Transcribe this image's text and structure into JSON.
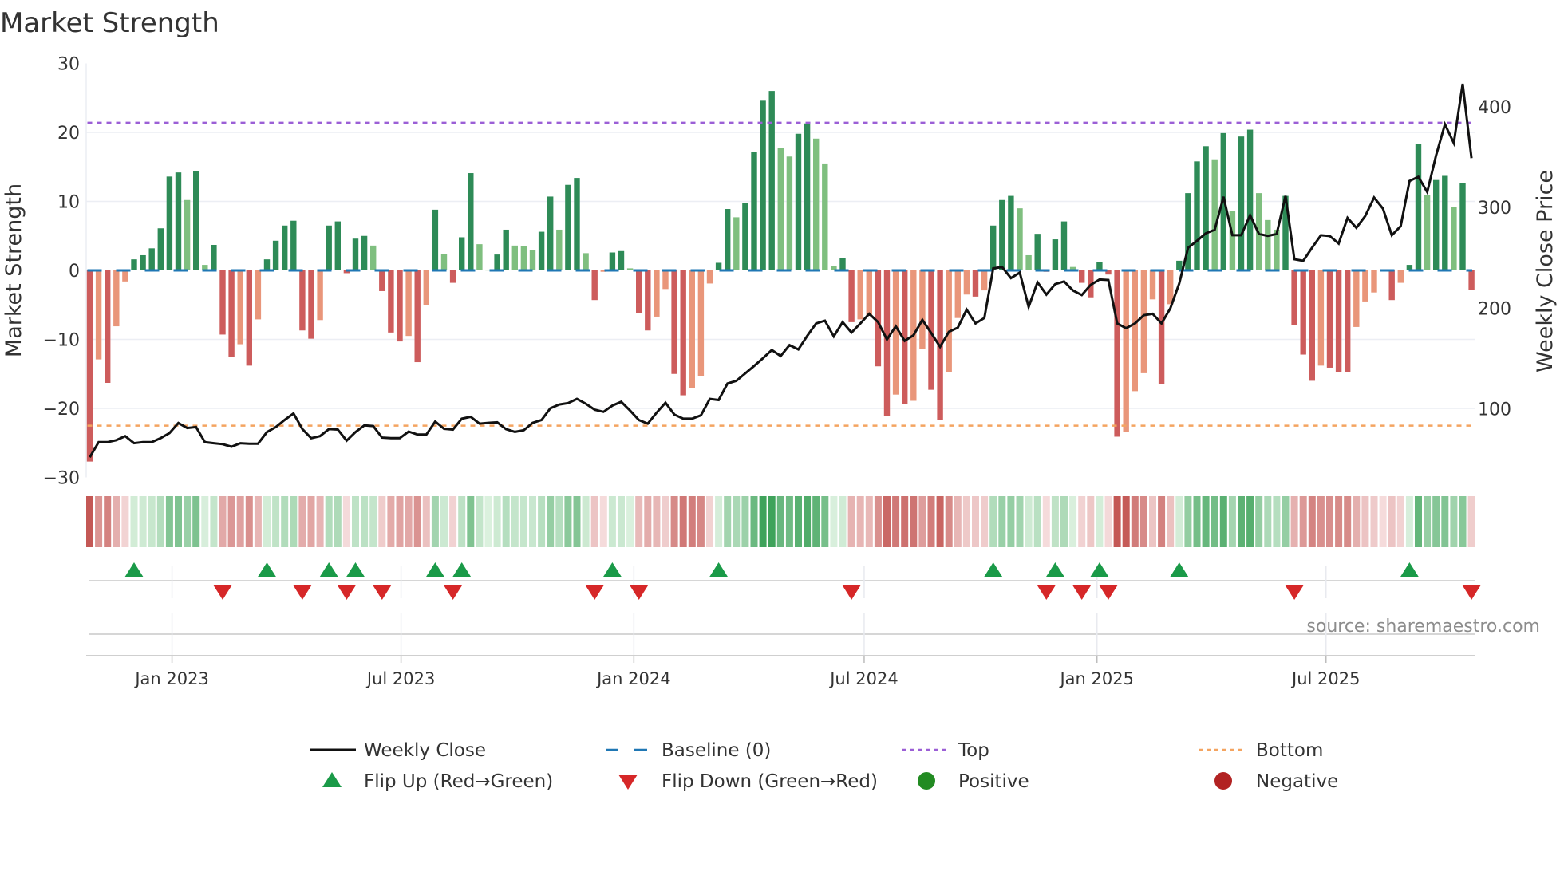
{
  "chart_data": {
    "type": "bar",
    "title": "Market Strength",
    "ylabel": "Market Strength",
    "ylabel_right": "Weekly Close Price",
    "ylim": [
      -30,
      30
    ],
    "ylim_right": [
      32,
      443
    ],
    "yticks": [
      30,
      20,
      10,
      0,
      -10,
      -20,
      -30
    ],
    "yticks_right": [
      400,
      300,
      200,
      100
    ],
    "x_start": "2022-10-28",
    "x_step_days": 7,
    "xticks": [
      {
        "date": "2023-01-01",
        "label": "Jan 2023"
      },
      {
        "date": "2023-07-01",
        "label": "Jul 2023"
      },
      {
        "date": "2024-01-01",
        "label": "Jan 2024"
      },
      {
        "date": "2024-07-01",
        "label": "Jul 2024"
      },
      {
        "date": "2025-01-01",
        "label": "Jan 2025"
      },
      {
        "date": "2025-07-01",
        "label": "Jul 2025"
      }
    ],
    "top_level": 21.4,
    "bottom_level": -22.5,
    "baseline": 0,
    "strength": [
      -27.7,
      -12.9,
      -16.3,
      -8.1,
      -1.6,
      1.6,
      2.2,
      3.2,
      6.1,
      13.6,
      14.2,
      10.2,
      14.4,
      0.8,
      3.7,
      -9.3,
      -12.5,
      -10.7,
      -13.8,
      -7.1,
      1.6,
      4.3,
      6.5,
      7.2,
      -8.7,
      -9.9,
      -7.2,
      6.5,
      7.1,
      -0.4,
      4.6,
      5.0,
      3.6,
      -3.0,
      -9.0,
      -10.3,
      -9.5,
      -13.3,
      -5.0,
      8.8,
      2.4,
      -1.8,
      4.8,
      14.1,
      3.8,
      0.1,
      2.3,
      5.9,
      3.6,
      3.5,
      3.0,
      5.6,
      10.7,
      5.9,
      12.4,
      13.4,
      2.5,
      -4.3,
      -0.2,
      2.6,
      2.8,
      0.3,
      -6.2,
      -8.7,
      -6.7,
      -2.7,
      -15.0,
      -18.1,
      -17.1,
      -15.3,
      -1.9,
      1.1,
      8.9,
      7.7,
      9.8,
      17.2,
      24.7,
      26.0,
      17.7,
      16.5,
      19.8,
      21.3,
      19.1,
      15.5,
      0.6,
      1.8,
      -7.5,
      -7.1,
      -6.6,
      -13.9,
      -21.1,
      -18.0,
      -19.4,
      -18.9,
      -11.4,
      -17.3,
      -21.7,
      -14.7,
      -6.9,
      -3.5,
      -3.8,
      -2.9,
      6.5,
      10.2,
      10.8,
      9.0,
      2.2,
      5.3,
      -0.2,
      4.5,
      7.1,
      0.5,
      -1.8,
      -3.9,
      1.2,
      -0.6,
      -24.1,
      -23.4,
      -17.5,
      -14.9,
      -4.2,
      -16.5,
      -4.9,
      1.4,
      11.2,
      15.8,
      18.0,
      16.1,
      19.9,
      8.6,
      19.4,
      20.4,
      11.2,
      7.3,
      5.9,
      10.8,
      -7.9,
      -12.2,
      -16.0,
      -13.8,
      -14.1,
      -14.7,
      -14.7,
      -8.2,
      -4.5,
      -3.2,
      -0.1,
      -4.3,
      -1.8,
      0.8,
      18.3,
      10.9,
      13.1,
      13.7,
      9.2,
      12.7,
      -2.8
    ],
    "weekly_close": [
      52,
      67,
      67,
      69,
      73,
      66,
      67,
      67,
      71,
      76,
      86,
      81,
      82,
      67,
      66,
      65,
      62.5,
      66,
      65.5,
      65.5,
      77,
      82,
      89,
      95.5,
      80,
      71,
      73,
      80,
      79.5,
      68.5,
      77,
      83.6,
      83,
      71.5,
      71,
      71,
      77.5,
      74.5,
      74.5,
      87.5,
      80.2,
      79.4,
      90.3,
      92.2,
      85.4,
      86.2,
      86.7,
      79.9,
      77.2,
      78.8,
      86.2,
      88.9,
      100.6,
      104.4,
      105.8,
      109.9,
      105.2,
      99.2,
      97.1,
      103.3,
      107.1,
      98.4,
      88.9,
      85.4,
      96.3,
      106.1,
      94.4,
      90.3,
      90.3,
      93.6,
      109.9,
      108.8,
      125.2,
      127.9,
      135.3,
      142.6,
      150.3,
      158.5,
      152.5,
      163.4,
      159,
      172.5,
      184.8,
      187.6,
      172,
      186.2,
      175.8,
      184.8,
      194.4,
      186.2,
      169,
      182.1,
      167.6,
      173.1,
      188.4,
      175.3,
      161.6,
      176.6,
      180.7,
      198.5,
      184.8,
      190.3,
      239.5,
      240.8,
      229.9,
      235.4,
      201.2,
      225.8,
      213.5,
      223.9,
      226.6,
      217.6,
      213,
      223.1,
      228.5,
      228,
      184.8,
      180.2,
      184.8,
      193,
      194.4,
      184.8,
      199.9,
      224.5,
      260,
      266.9,
      274.3,
      277.8,
      310.6,
      272.4,
      272.4,
      292.3,
      273.7,
      271.8,
      273.7,
      311.5,
      248.6,
      247,
      260.1,
      272.4,
      271.6,
      264.2,
      289.6,
      279.8,
      291.5,
      309.8,
      298.9,
      272.4,
      281.4,
      326.3,
      330.4,
      315.3,
      351.7,
      382.5,
      364,
      422.7,
      348.9
    ],
    "legend": {
      "placement": "bottom",
      "items": [
        {
          "key": "weekly_close",
          "label": "Weekly Close"
        },
        {
          "key": "baseline",
          "label": "Baseline (0)"
        },
        {
          "key": "top",
          "label": "Top"
        },
        {
          "key": "bottom",
          "label": "Bottom"
        },
        {
          "key": "flip_up",
          "label": "Flip Up (Red→Green)"
        },
        {
          "key": "flip_down",
          "label": "Flip Down (Green→Red)"
        },
        {
          "key": "positive",
          "label": "Positive"
        },
        {
          "key": "negative",
          "label": "Negative"
        }
      ]
    },
    "source": "source: sharemaestro.com",
    "colors": {
      "pos_strong": "#2e8b57",
      "pos_weak": "#7fbf7f",
      "neg_strong": "#cd5c5c",
      "neg_weak": "#e9967a",
      "line": "#111111",
      "baseline": "#1f77b4",
      "top": "#9b5fd6",
      "bottom": "#f4a460",
      "flip_up": "#1a9a48",
      "flip_down": "#d62728",
      "positive": "#228b22",
      "negative": "#b22222",
      "grid": "#eceef4"
    }
  }
}
